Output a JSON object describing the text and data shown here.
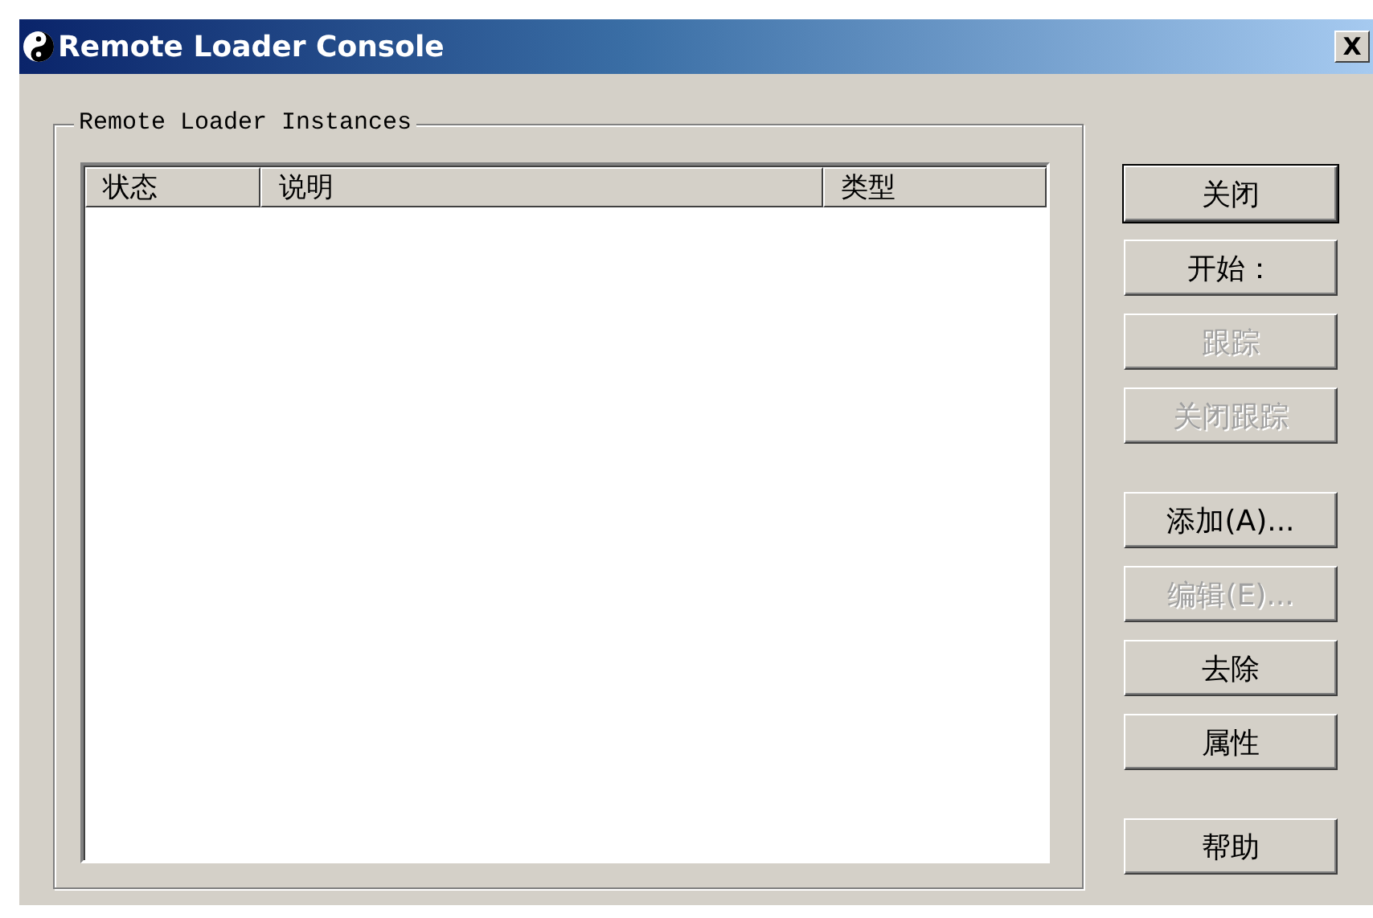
{
  "window": {
    "title": "Remote Loader Console",
    "close_label": "X"
  },
  "group": {
    "label": "Remote Loader Instances",
    "columns": [
      "状态",
      "说明",
      "类型"
    ]
  },
  "button_groups": [
    [
      {
        "label": "关闭",
        "default": true,
        "disabled": false
      },
      {
        "label": "开始：",
        "default": false,
        "disabled": false
      },
      {
        "label": "跟踪",
        "default": false,
        "disabled": true
      },
      {
        "label": "关闭跟踪",
        "default": false,
        "disabled": true
      }
    ],
    [
      {
        "label": "添加(A)...",
        "default": false,
        "disabled": false
      },
      {
        "label": "编辑(E)...",
        "default": false,
        "disabled": true
      },
      {
        "label": "去除",
        "default": false,
        "disabled": false
      },
      {
        "label": "属性",
        "default": false,
        "disabled": false
      }
    ],
    [
      {
        "label": "帮助",
        "default": false,
        "disabled": false
      }
    ]
  ]
}
